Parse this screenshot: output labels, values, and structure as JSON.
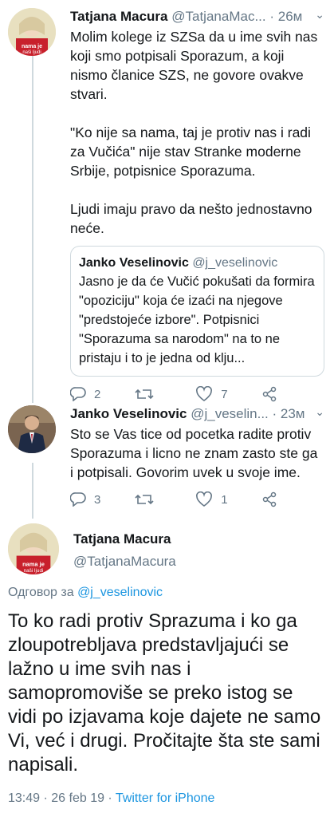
{
  "tweet1": {
    "name": "Tatjana Macura",
    "handle": "@TatjanaMac...",
    "time": "· 26м",
    "paragraphs": [
      "Molim kolege iz SZSa da u ime svih nas koji smo potpisali Sporazum, a koji nismo članice SZS, ne govore ovakve stvari.",
      "\"Ko nije sa nama, taj je protiv nas i radi za Vučića\" nije stav Stranke moderne Srbije, potpisnice Sporazuma.",
      "Ljudi imaju pravo da nešto jednostavno neće."
    ],
    "quote": {
      "name": "Janko Veselinovic",
      "handle": "@j_veselinovic",
      "text": "Jasno je da će Vučić pokušati da formira \"opoziciju\" koja će izaći na njegove \"predstojeće izbore\". Potpisnici \"Sporazuma sa narodom\" na to ne pristaju i to je jedna od klju..."
    },
    "replies": "2",
    "retweets": "",
    "likes": "7"
  },
  "tweet2": {
    "name": "Janko Veselinovic",
    "handle": "@j_veselin...",
    "time": "· 23м",
    "text": "Sto se Vas tice od pocetka radite protiv Sporazuma i licno ne znam zasto ste ga i potpisali. Govorim uvek u svoje ime.",
    "replies": "3",
    "retweets": "",
    "likes": "1"
  },
  "tweet3": {
    "name": "Tatjana Macura",
    "handle": "@TatjanaMacura",
    "replying_prefix": "Одговор за",
    "replying_to": "@j_veselinovic",
    "text": "To ko radi protiv Sprazuma i ko ga zloupotrebljava predstavljajući se lažno u ime svih nas i samopromoviše se preko istog se vidi po izjavama koje dajete ne samo Vi, već i drugi. Pročitajte šta ste sami napisali.",
    "timestamp": "13:49 · 26 feb 19 ·",
    "source": "Twitter for iPhone"
  },
  "avatar_text": "nama je naši ljudi",
  "colors": {
    "link": "#1b95e0",
    "muted": "#657786",
    "border": "#cfd9de"
  }
}
